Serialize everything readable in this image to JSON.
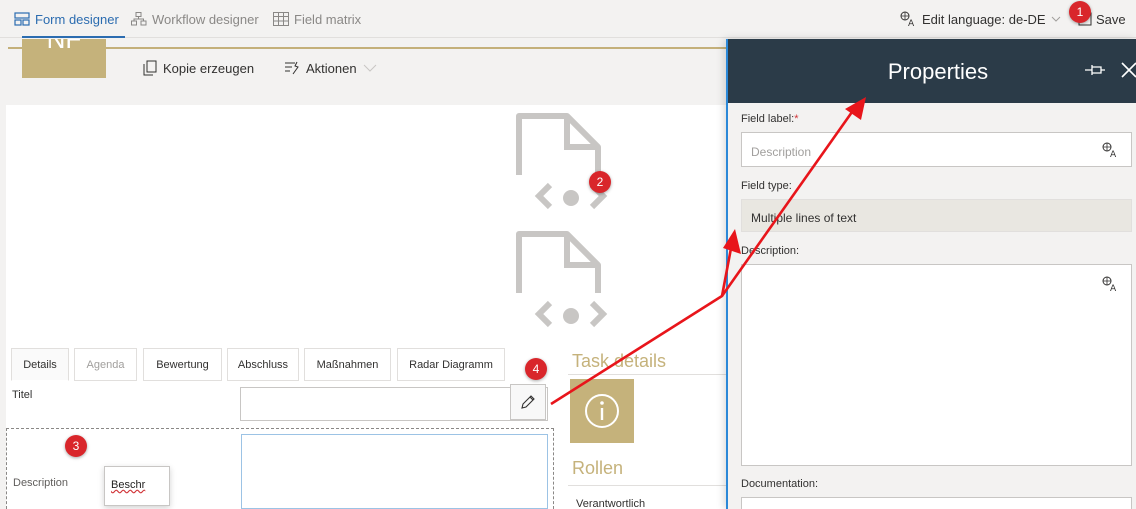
{
  "topbar": {
    "tabs": [
      {
        "label": "Form designer",
        "icon": "form-icon"
      },
      {
        "label": "Workflow designer",
        "icon": "workflow-icon"
      },
      {
        "label": "Field matrix",
        "icon": "matrix-icon"
      }
    ],
    "edit_language": "Edit language: de-DE",
    "save_label": "Save"
  },
  "header": {
    "logo_text": "NF",
    "commands": {
      "copy": "Kopie erzeugen",
      "actions": "Aktionen"
    }
  },
  "form": {
    "tabs": [
      "Details",
      "Agenda",
      "Bewertung",
      "Abschluss",
      "Maßnahmen",
      "Radar Diagramm"
    ],
    "fields": {
      "titel_label": "Titel",
      "description_label": "Description",
      "description_edit_value": "Beschr"
    },
    "side": {
      "task_details": "Task details",
      "rollen": "Rollen",
      "verantwortlich": "Verantwortlich"
    }
  },
  "panel": {
    "title": "Properties",
    "field_label": "Field label:",
    "required_mark": "*",
    "field_label_placeholder": "Description",
    "field_type_label": "Field type:",
    "field_type_value": "Multiple lines of text",
    "description_label": "Description:",
    "documentation_label": "Documentation:"
  },
  "annotations": {
    "badges": [
      "1",
      "2",
      "3",
      "4"
    ],
    "color": "#d9262b"
  },
  "colors": {
    "accent_gold": "#c5b27b",
    "panel_header": "#2b3b48",
    "link_blue": "#2b6cb0"
  }
}
